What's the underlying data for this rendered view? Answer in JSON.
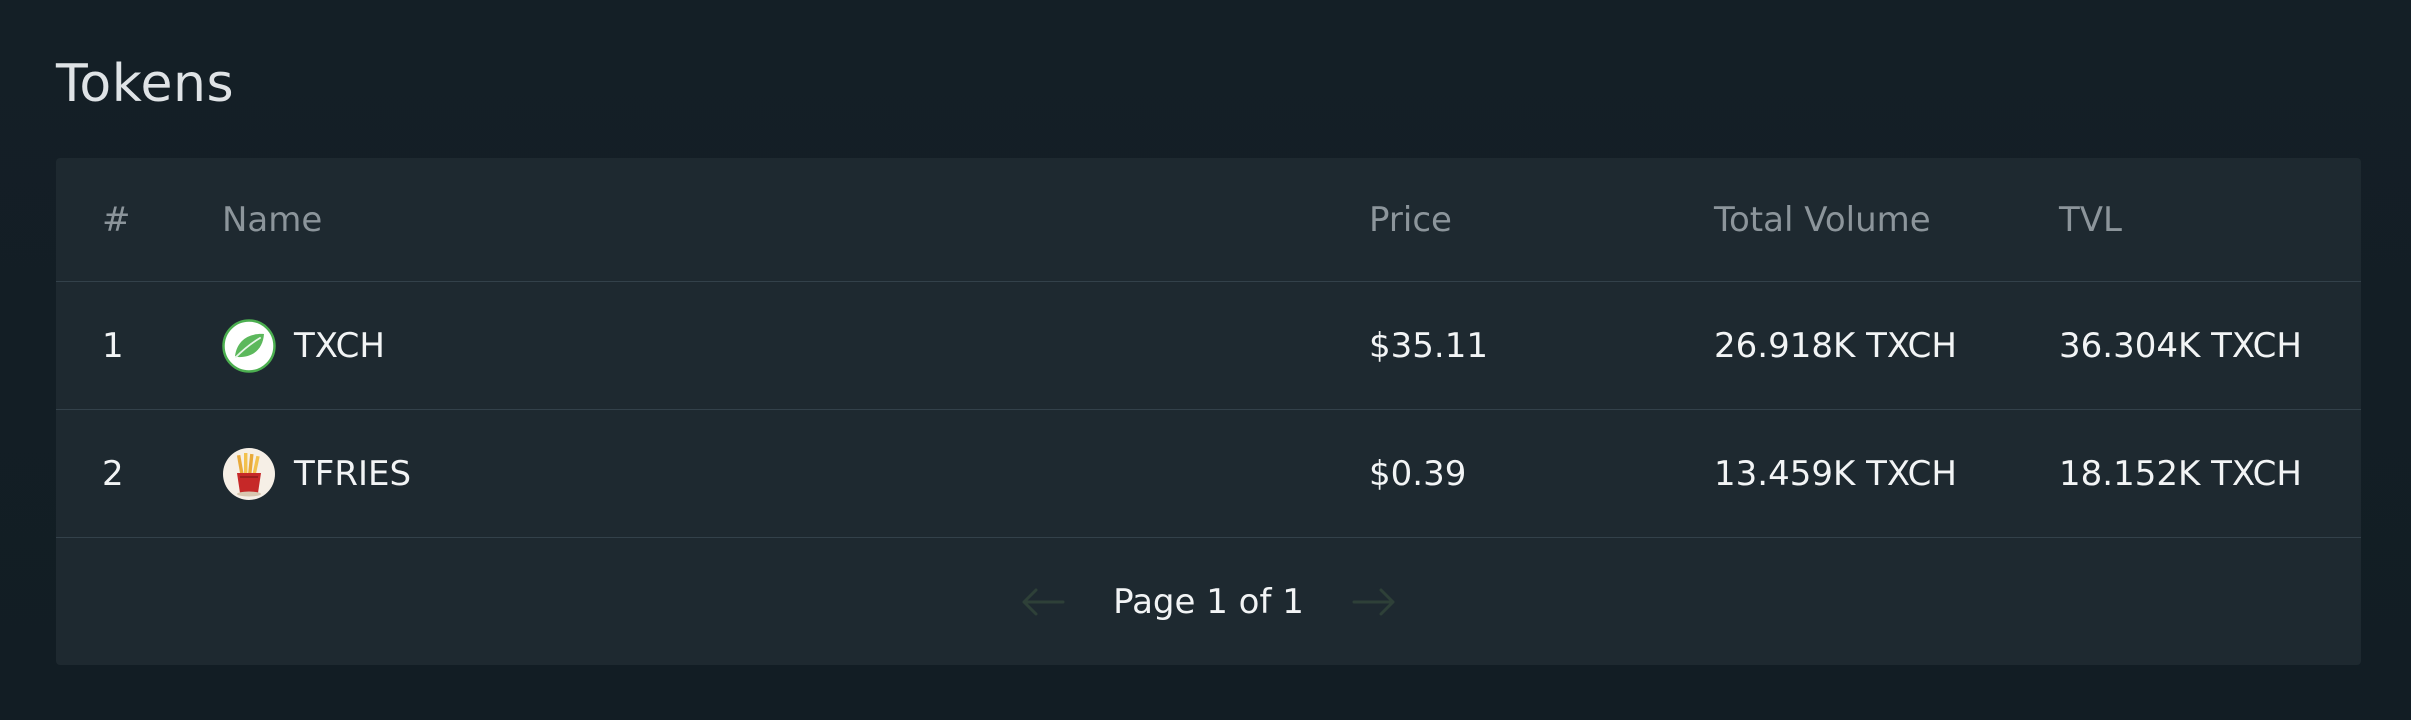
{
  "page": {
    "title": "Tokens"
  },
  "table": {
    "headers": {
      "num": "#",
      "name": "Name",
      "price": "Price",
      "volume": "Total Volume",
      "tvl": "TVL"
    },
    "rows": [
      {
        "num": "1",
        "name": "TXCH",
        "icon": "leaf-icon",
        "price": "$35.11",
        "volume": "26.918K TXCH",
        "tvl": "36.304K TXCH"
      },
      {
        "num": "2",
        "name": "TFRIES",
        "icon": "fries-icon",
        "price": "$0.39",
        "volume": "13.459K TXCH",
        "tvl": "18.152K TXCH"
      }
    ]
  },
  "pagination": {
    "label": "Page 1 of 1",
    "prev_icon": "arrow-left-icon",
    "next_icon": "arrow-right-icon"
  },
  "colors": {
    "background": "#131e25",
    "card": "#1e2930",
    "divider": "#33414a",
    "header_text": "#8c959b",
    "text": "#f2f4f5",
    "arrow_disabled": "#2e4038",
    "leaf_green": "#4caf50"
  }
}
